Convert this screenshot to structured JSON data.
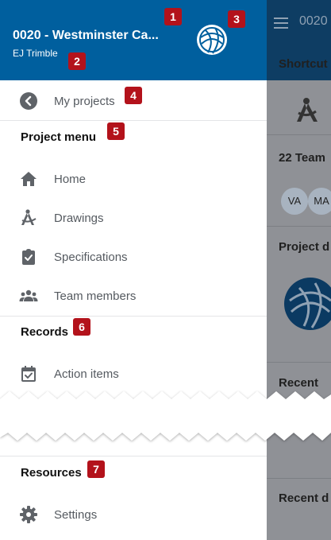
{
  "header": {
    "project_title": "0020 - Westminster Ca...",
    "user_name": "EJ Trimble"
  },
  "back_link": {
    "label": "My projects"
  },
  "project_menu": {
    "title": "Project menu",
    "items": [
      {
        "label": "Home",
        "icon": "home-icon"
      },
      {
        "label": "Drawings",
        "icon": "drawings-icon"
      },
      {
        "label": "Specifications",
        "icon": "specifications-icon"
      },
      {
        "label": "Team members",
        "icon": "team-members-icon"
      }
    ]
  },
  "records": {
    "title": "Records",
    "items": [
      {
        "label": "Action items",
        "icon": "calendar-check-icon"
      }
    ]
  },
  "resources": {
    "title": "Resources",
    "items": [
      {
        "label": "Settings",
        "icon": "gear-icon"
      }
    ]
  },
  "callouts": [
    "1",
    "2",
    "3",
    "4",
    "5",
    "6",
    "7"
  ],
  "background": {
    "topbar_text": "0020",
    "shortcuts_label": "Shortcut",
    "team_label": "22 Team",
    "avatars": [
      "VA",
      "MA"
    ],
    "project_label": "Project d",
    "recent_label_1": "Recent",
    "recent_label_2": "Recent d"
  },
  "colors": {
    "header_bg": "#005f9e",
    "badge": "#b3121b",
    "overlay": "#8f9196"
  }
}
